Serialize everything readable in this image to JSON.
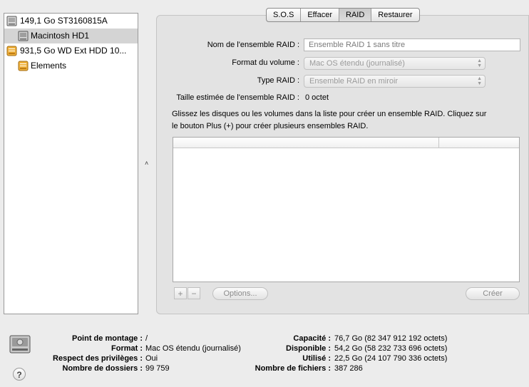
{
  "sidebar": {
    "items": [
      {
        "label": "149,1 Go ST3160815A",
        "icon": "internal-disk-icon"
      },
      {
        "label": "Macintosh HD1",
        "icon": "volume-icon"
      },
      {
        "label": "931,5 Go WD Ext HDD 10...",
        "icon": "external-disk-icon"
      },
      {
        "label": "Elements",
        "icon": "external-volume-icon"
      }
    ]
  },
  "splitter_glyph": "˄",
  "tabs": [
    "S.O.S",
    "Effacer",
    "RAID",
    "Restaurer"
  ],
  "active_tab": "RAID",
  "raid": {
    "name_label": "Nom de l'ensemble RAID :",
    "name_value": "Ensemble RAID 1 sans titre",
    "format_label": "Format du volume :",
    "format_value": "Mac OS étendu (journalisé)",
    "type_label": "Type RAID :",
    "type_value": "Ensemble RAID en miroir",
    "size_label": "Taille estimée de l'ensemble RAID :",
    "size_value": "0 octet",
    "instructions_line1": "Glissez les disques ou les volumes dans la liste pour créer un ensemble RAID. Cliquez sur",
    "instructions_line2": "le bouton Plus (+) pour créer plusieurs ensembles RAID.",
    "add_label": "+",
    "remove_label": "−",
    "options_label": "Options...",
    "create_label": "Créer"
  },
  "info": {
    "mount_label": "Point de montage :",
    "mount_value": "/",
    "format_label": "Format :",
    "format_value": "Mac OS étendu (journalisé)",
    "privileges_label": "Respect des privilèges :",
    "privileges_value": "Oui",
    "folders_label": "Nombre de dossiers :",
    "folders_value": "99 759",
    "capacity_label": "Capacité :",
    "capacity_value": "76,7 Go (82 347 912 192 octets)",
    "available_label": "Disponible :",
    "available_value": "54,2 Go (58 232 733 696 octets)",
    "used_label": "Utilisé :",
    "used_value": "22,5 Go (24 107 790 336 octets)",
    "files_label": "Nombre de fichiers :",
    "files_value": "387 286"
  },
  "help_label": "?",
  "colors": {
    "window_bg": "#ececec",
    "panel_bg": "#e3e3e3",
    "selection_bg": "#d4d4d4",
    "drive_orange": "#e8a22c"
  }
}
